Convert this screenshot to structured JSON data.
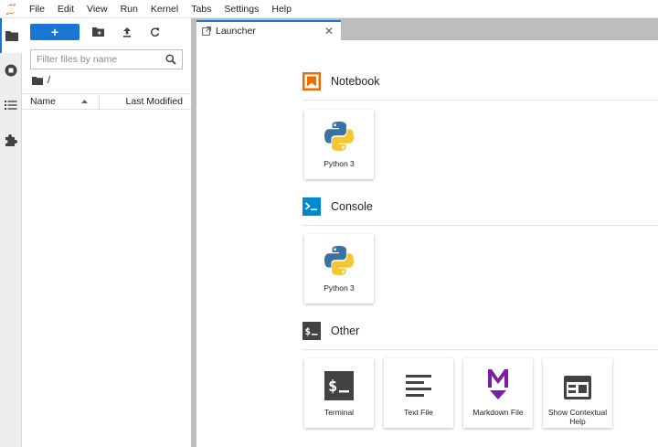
{
  "menu": [
    "File",
    "Edit",
    "View",
    "Run",
    "Kernel",
    "Tabs",
    "Settings",
    "Help"
  ],
  "activity": [
    {
      "name": "folder-icon"
    },
    {
      "name": "stop-circle-icon"
    },
    {
      "name": "list-icon"
    },
    {
      "name": "puzzle-icon"
    }
  ],
  "filebrowser": {
    "new_label": "+",
    "filter_placeholder": "Filter files by name",
    "breadcrumb": "/",
    "columns": {
      "name": "Name",
      "modified": "Last Modified"
    }
  },
  "tabs": [
    {
      "label": "Launcher"
    }
  ],
  "launcher": {
    "sections": [
      {
        "title": "Notebook",
        "icon": "notebook-icon",
        "items": [
          {
            "label": "Python 3",
            "icon": "python-icon"
          }
        ]
      },
      {
        "title": "Console",
        "icon": "console-icon",
        "items": [
          {
            "label": "Python 3",
            "icon": "python-icon"
          }
        ]
      },
      {
        "title": "Other",
        "icon": "other-icon",
        "items": [
          {
            "label": "Terminal",
            "icon": "terminal-icon"
          },
          {
            "label": "Text File",
            "icon": "text-file-icon"
          },
          {
            "label": "Markdown File",
            "icon": "markdown-icon"
          },
          {
            "label": "Show Contextual Help",
            "icon": "contextual-help-icon"
          }
        ]
      }
    ]
  },
  "colors": {
    "accent": "#1976d2",
    "notebook": "#ef6c00",
    "console": "#0288d1",
    "markdown": "#7b1fa2",
    "python_blue": "#3a72a4",
    "python_yellow": "#f5c634"
  }
}
